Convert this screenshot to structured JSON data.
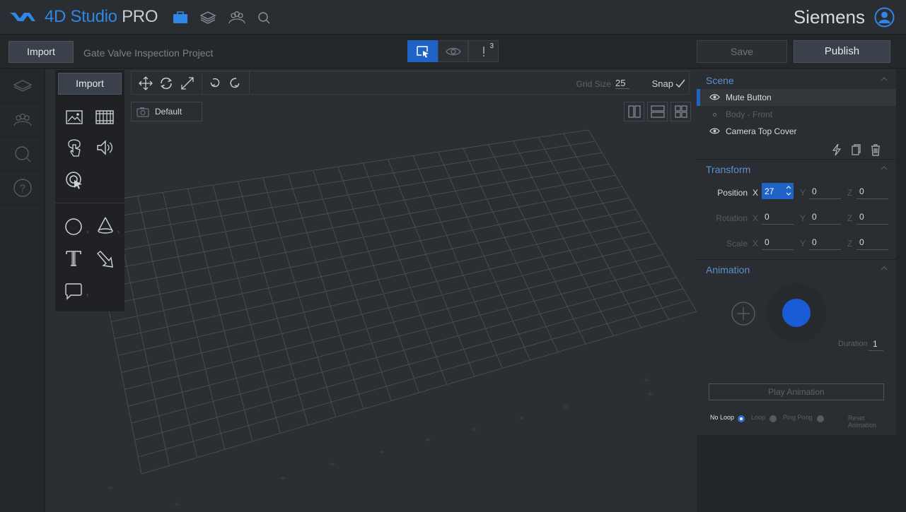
{
  "header": {
    "app_name": "4D Studio",
    "app_suffix": "PRO",
    "brand": "Siemens",
    "icons": [
      "logo-icon",
      "briefcase-icon",
      "layers-icon",
      "users-icon",
      "search-icon",
      "user-account-icon"
    ]
  },
  "toolbar": {
    "import_label": "Import",
    "project_name": "Gate Valve Inspection Project",
    "modes": [
      "select-mode-icon",
      "preview-eye-icon",
      "alerts-icon"
    ],
    "alert_count": "3",
    "save_label": "Save",
    "publish_label": "Publish"
  },
  "leftnav": {
    "items": [
      "layers-icon",
      "users-icon",
      "search-icon",
      "help-icon"
    ]
  },
  "canvas_toolbar": {
    "tools": [
      "move-icon",
      "rotate-icon",
      "scale-icon",
      "undo-icon",
      "redo-icon"
    ],
    "grid_size_label": "Grid Size",
    "grid_size_value": "25",
    "snap_label": "Snap",
    "snap_enabled": true
  },
  "camera": {
    "label": "Default"
  },
  "view_layouts": [
    "split-vertical-icon",
    "split-horizontal-icon",
    "quad-view-icon"
  ],
  "insert_panel": {
    "import_label": "Import",
    "items": [
      "image-icon",
      "video-icon",
      "hotspot-touch-icon",
      "audio-icon",
      "target-icon",
      "circle-shape-icon",
      "cone-shape-icon",
      "text-icon",
      "arrow-icon",
      "callout-bubble-icon"
    ]
  },
  "scene": {
    "title": "Scene",
    "items": [
      {
        "label": "Mute Button",
        "visible": true,
        "selected": true
      },
      {
        "label": "Body - Front",
        "visible": false,
        "selected": false
      },
      {
        "label": "Camera Top Cover",
        "visible": true,
        "selected": false
      }
    ],
    "actions": [
      "lightning-icon",
      "duplicate-icon",
      "trash-icon"
    ]
  },
  "transform": {
    "title": "Transform",
    "position": {
      "label": "Position",
      "x": "27",
      "y": "0",
      "z": "0"
    },
    "rotation": {
      "label": "Rotation",
      "x": "0",
      "y": "0",
      "z": "0"
    },
    "scale": {
      "label": "Scale",
      "x": "0",
      "y": "0",
      "z": "0"
    },
    "axis_x": "X",
    "axis_y": "Y",
    "axis_z": "Z"
  },
  "animation": {
    "title": "Animation",
    "duration_label": "Duration",
    "duration_value": "1",
    "play_label": "Play Animation",
    "loop_options": [
      {
        "label": "No Loop",
        "selected": true
      },
      {
        "label": "Loop",
        "selected": false
      },
      {
        "label": "Ping Pong",
        "selected": false
      }
    ],
    "reset_label": "Reset Animation"
  },
  "colors": {
    "accent": "#1f63c7",
    "logo_blue": "#2f86e6",
    "section_title": "#5d8fd0",
    "background": "#232629"
  }
}
